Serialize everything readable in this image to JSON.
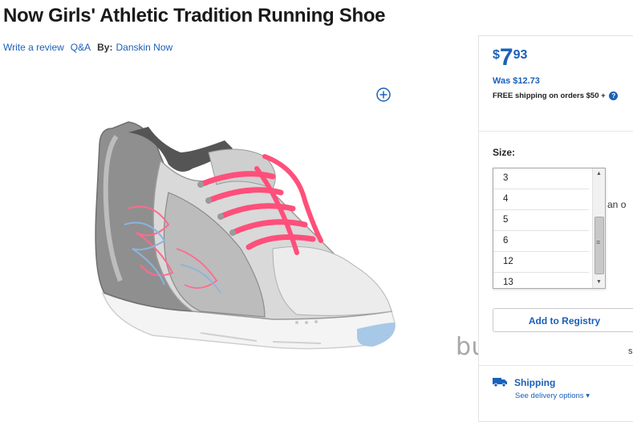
{
  "product": {
    "title": "Now Girls' Athletic Tradition Running Shoe",
    "write_review": "Write a review",
    "qa": "Q&A",
    "by_label": "By:",
    "brand": "Danskin Now"
  },
  "price": {
    "dollar_sign": "$",
    "dollars": "7",
    "cents": "93",
    "was": "Was $12.73",
    "free_shipping": "FREE shipping on orders $50 +",
    "help_icon_glyph": "?"
  },
  "size": {
    "label": "Size:",
    "options": [
      "3",
      "4",
      "5",
      "6",
      "12",
      "13"
    ],
    "behind_text": "e an o"
  },
  "registry": {
    "button_label": "Add to Registry",
    "cut_letter": "s"
  },
  "shipping": {
    "title": "Shipping",
    "delivery_link": "See delivery options ▾"
  },
  "watermark": "buy_brands",
  "icons": {
    "zoom": "zoom-in-icon",
    "truck": "truck-icon"
  },
  "colors": {
    "accent_blue": "#1a60b8",
    "lace_pink": "#ff4f7a",
    "sole_blue": "#a8c8e8"
  }
}
